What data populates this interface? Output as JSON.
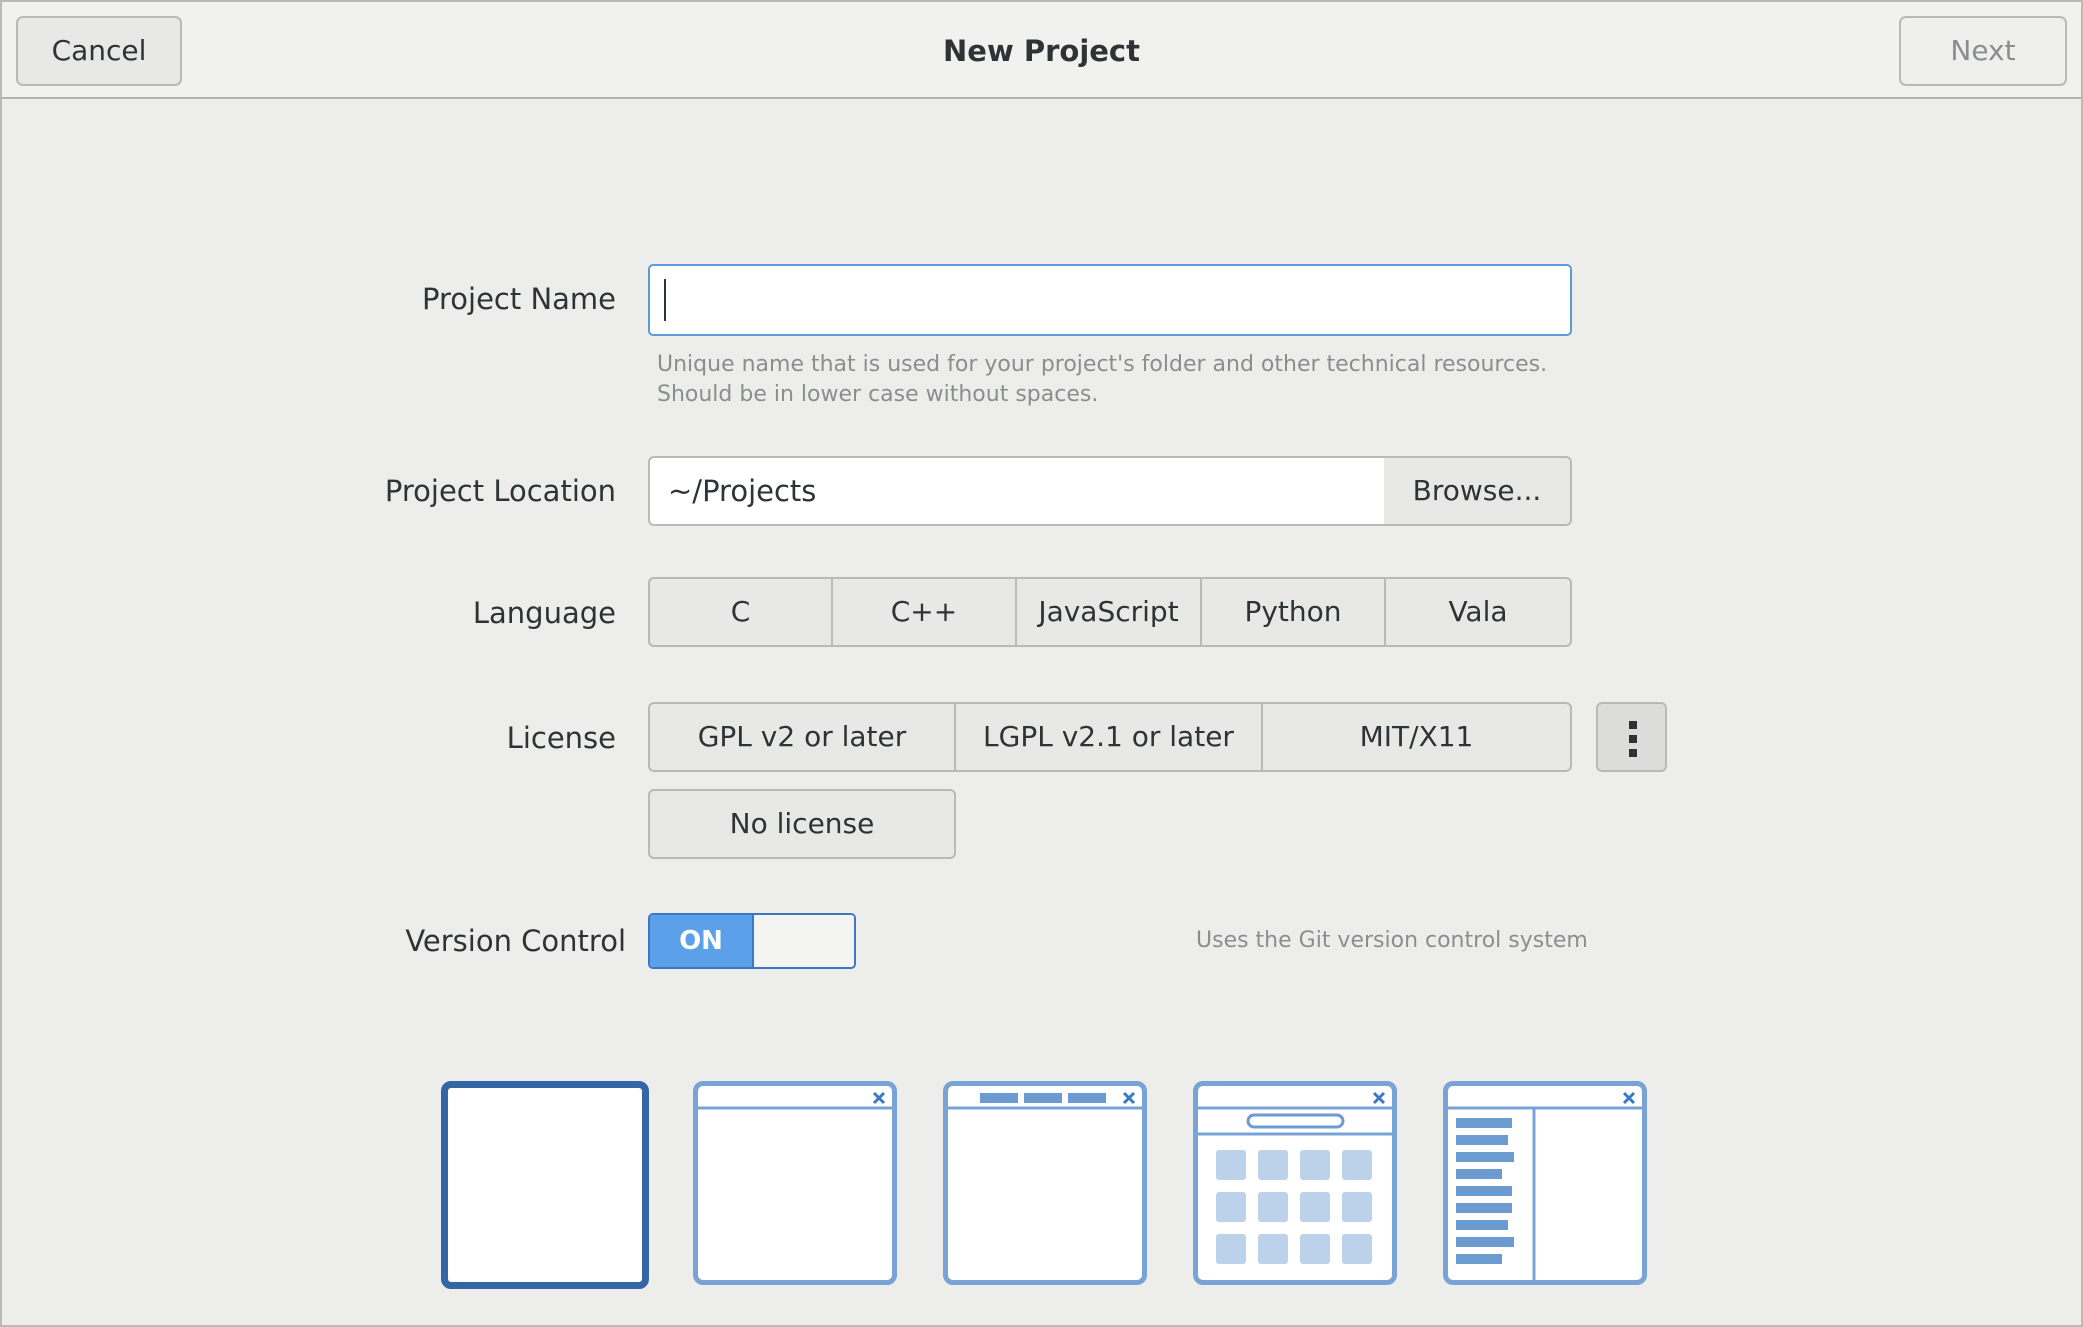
{
  "header": {
    "title": "New Project",
    "cancel_label": "Cancel",
    "next_label": "Next"
  },
  "form": {
    "project_name": {
      "label": "Project Name",
      "value": "",
      "hint_line1": "Unique name that is used for your project's folder and other technical resources.",
      "hint_line2": "Should be in lower case without spaces."
    },
    "project_location": {
      "label": "Project Location",
      "value": "~/Projects",
      "browse_label": "Browse..."
    },
    "language": {
      "label": "Language",
      "options": [
        "C",
        "C++",
        "JavaScript",
        "Python",
        "Vala"
      ]
    },
    "license": {
      "label": "License",
      "options": [
        "GPL v2 or later",
        "LGPL v2.1 or later",
        "MIT/X11"
      ],
      "no_license_label": "No license",
      "more_icon": "vertical-ellipsis-icon"
    },
    "version_control": {
      "label": "Version Control",
      "state_label": "ON",
      "enabled": true,
      "description": "Uses the Git version control system"
    }
  },
  "templates": [
    {
      "icon": "empty-project-icon",
      "selected": true
    },
    {
      "icon": "gtk-application-icon",
      "selected": false
    },
    {
      "icon": "application-with-tabs-icon",
      "selected": false
    },
    {
      "icon": "application-with-grid-icon",
      "selected": false
    },
    {
      "icon": "application-with-sidebar-icon",
      "selected": false
    }
  ],
  "colors": {
    "accent": "#5ca0e9",
    "selected_border": "#3465a4",
    "tile_border": "#78a3d4"
  }
}
